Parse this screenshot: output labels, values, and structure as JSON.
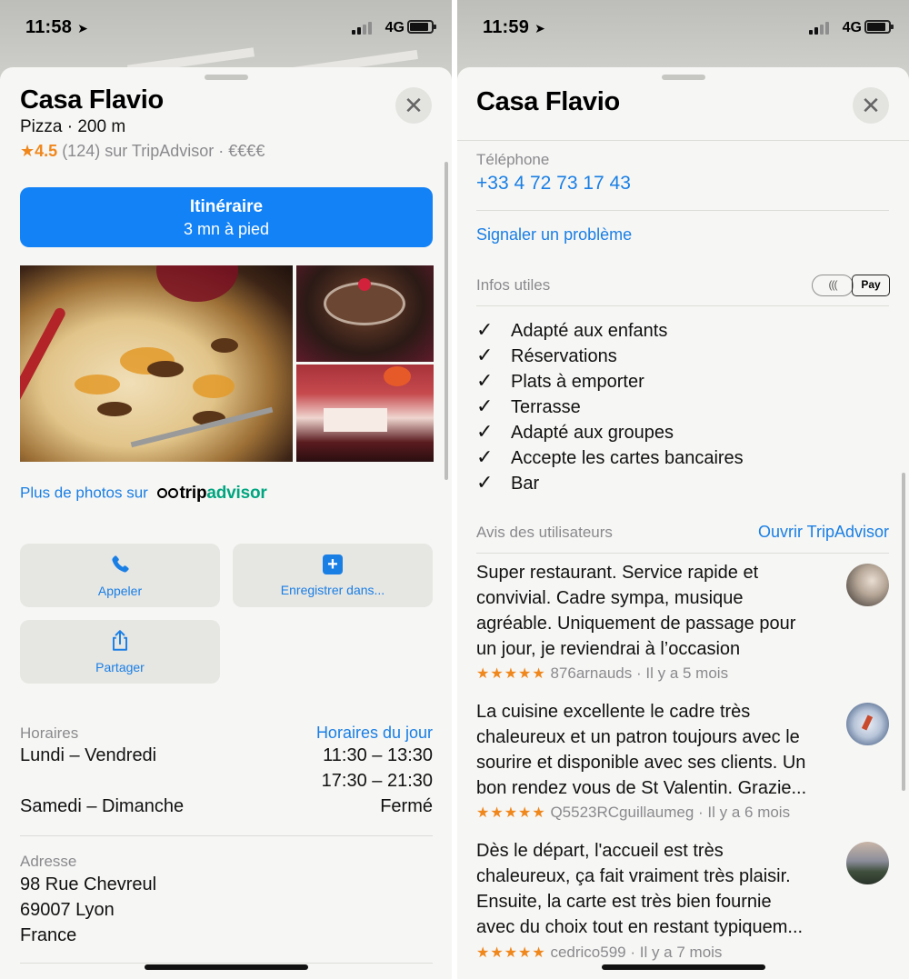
{
  "left": {
    "status": {
      "time": "11:58",
      "network": "4G"
    },
    "title": "Casa Flavio",
    "subtitle": "Pizza · 200 m",
    "rating": {
      "star": "★",
      "score": "4.5",
      "count": "(124)",
      "source": "sur TripAdvisor",
      "price": "€€€€"
    },
    "route": {
      "label": "Itinéraire",
      "sub": "3 mn à pied"
    },
    "more_photos": "Plus de photos sur",
    "tripadvisor": {
      "trip": "trip",
      "advisor": "advisor"
    },
    "actions": {
      "call": "Appeler",
      "save": "Enregistrer dans...",
      "share": "Partager"
    },
    "hours": {
      "label": "Horaires",
      "link": "Horaires du jour",
      "rows": [
        {
          "days": "Lundi – Vendredi",
          "time": "11:30 – 13:30"
        },
        {
          "days": "",
          "time": "17:30 – 21:30"
        },
        {
          "days": "Samedi – Dimanche",
          "time": "Fermé"
        }
      ]
    },
    "address": {
      "label": "Adresse",
      "lines": [
        "98 Rue Chevreul",
        "69007 Lyon",
        "France"
      ]
    }
  },
  "right": {
    "status": {
      "time": "11:59",
      "network": "4G"
    },
    "title": "Casa Flavio",
    "phone_label": "Téléphone",
    "phone": "+33 4 72 73 17 43",
    "report": "Signaler un problème",
    "info_label": "Infos utiles",
    "nfc_label": "(((",
    "applepay_label": " Pay",
    "features": [
      "Adapté aux enfants",
      "Réservations",
      "Plats à emporter",
      "Terrasse",
      "Adapté aux groupes",
      "Accepte les cartes bancaires",
      "Bar"
    ],
    "reviews_label": "Avis des utilisateurs",
    "reviews_link": "Ouvrir TripAdvisor",
    "reviews": [
      {
        "lines": [
          "Super restaurant. Service rapide et",
          "convivial. Cadre sympa, musique",
          "agréable. Uniquement de passage pour",
          "un jour, je reviendrai à l’occasion"
        ],
        "stars": "★★★★★",
        "author": "876arnauds",
        "when": "Il y a 5 mois"
      },
      {
        "lines": [
          "La cuisine excellente le cadre très",
          "chaleureux et un patron toujours avec le",
          "sourire et disponible avec ses clients. Un",
          "bon rendez vous de St Valentin. Grazie..."
        ],
        "stars": "★★★★★",
        "author": "Q5523RCguillaumeg",
        "when": "Il y a 6 mois"
      },
      {
        "lines": [
          "Dès le départ, l'accueil est très",
          "chaleureux, ça fait vraiment très plaisir.",
          "Ensuite, la carte est très bien fournie",
          "avec du choix tout en restant typiquem..."
        ],
        "stars": "★★★★★",
        "author": "cedrico599",
        "when": "Il y a 7 mois"
      }
    ]
  },
  "icons": {
    "close": "✕",
    "check": "✓",
    "location_arrow": "➤"
  },
  "colors": {
    "accent": "#1282f6",
    "link": "#1a7fe5",
    "star": "#f0871c",
    "tripadvisor": "#00a680"
  }
}
